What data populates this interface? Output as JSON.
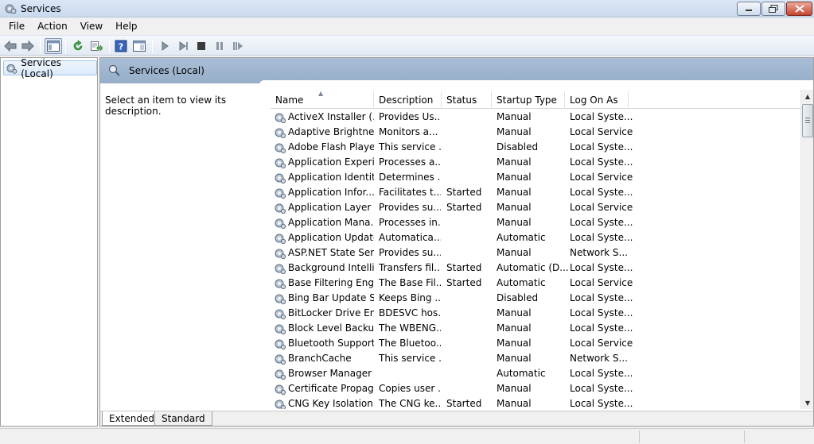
{
  "window": {
    "title": "Services",
    "icon": "services-gear-icon",
    "buttons": {
      "minimize": "minimize-icon",
      "maximize": "restore-icon",
      "close": "close-icon"
    }
  },
  "menu": {
    "items": [
      {
        "label": "File"
      },
      {
        "label": "Action"
      },
      {
        "label": "View"
      },
      {
        "label": "Help"
      }
    ]
  },
  "toolbar": {
    "icons": [
      "back-arrow-icon",
      "forward-arrow-icon",
      "show-hide-console-tree-icon",
      "refresh-icon",
      "export-list-icon",
      "help-icon",
      "properties-pane-icon",
      "start-service-icon",
      "start-alt-service-icon",
      "stop-service-icon",
      "pause-service-icon",
      "resume-service-icon"
    ]
  },
  "tree": {
    "root_label": "Services (Local)"
  },
  "main": {
    "header_title": "Services (Local)",
    "description_hint": "Select an item to view its description.",
    "columns": [
      "Name",
      "Description",
      "Status",
      "Startup Type",
      "Log On As"
    ],
    "rows": [
      {
        "name": "ActiveX Installer (...",
        "description": "Provides Us...",
        "status": "",
        "startup": "Manual",
        "logon": "Local Syste..."
      },
      {
        "name": "Adaptive Brightness",
        "description": "Monitors a...",
        "status": "",
        "startup": "Manual",
        "logon": "Local Service"
      },
      {
        "name": "Adobe Flash Playe...",
        "description": "This service ...",
        "status": "",
        "startup": "Disabled",
        "logon": "Local Syste..."
      },
      {
        "name": "Application Experi...",
        "description": "Processes a...",
        "status": "",
        "startup": "Manual",
        "logon": "Local Syste..."
      },
      {
        "name": "Application Identity",
        "description": "Determines ...",
        "status": "",
        "startup": "Manual",
        "logon": "Local Service"
      },
      {
        "name": "Application Infor...",
        "description": "Facilitates t...",
        "status": "Started",
        "startup": "Manual",
        "logon": "Local Syste..."
      },
      {
        "name": "Application Layer ...",
        "description": "Provides su...",
        "status": "Started",
        "startup": "Manual",
        "logon": "Local Service"
      },
      {
        "name": "Application Mana...",
        "description": "Processes in...",
        "status": "",
        "startup": "Manual",
        "logon": "Local Syste..."
      },
      {
        "name": "Application Updater",
        "description": "Automatica...",
        "status": "",
        "startup": "Automatic",
        "logon": "Local Syste..."
      },
      {
        "name": "ASP.NET State Ser...",
        "description": "Provides su...",
        "status": "",
        "startup": "Manual",
        "logon": "Network S..."
      },
      {
        "name": "Background Intelli...",
        "description": "Transfers fil...",
        "status": "Started",
        "startup": "Automatic (D...",
        "logon": "Local Syste..."
      },
      {
        "name": "Base Filtering Engi...",
        "description": "The Base Fil...",
        "status": "Started",
        "startup": "Automatic",
        "logon": "Local Service"
      },
      {
        "name": "Bing Bar Update S...",
        "description": "Keeps Bing ...",
        "status": "",
        "startup": "Disabled",
        "logon": "Local Syste..."
      },
      {
        "name": "BitLocker Drive En...",
        "description": "BDESVC hos...",
        "status": "",
        "startup": "Manual",
        "logon": "Local Syste..."
      },
      {
        "name": "Block Level Backu...",
        "description": "The WBENG...",
        "status": "",
        "startup": "Manual",
        "logon": "Local Syste..."
      },
      {
        "name": "Bluetooth Support...",
        "description": "The Bluetoo...",
        "status": "",
        "startup": "Manual",
        "logon": "Local Service"
      },
      {
        "name": "BranchCache",
        "description": "This service ...",
        "status": "",
        "startup": "Manual",
        "logon": "Network S..."
      },
      {
        "name": "Browser Manager",
        "description": "",
        "status": "",
        "startup": "Automatic",
        "logon": "Local Syste..."
      },
      {
        "name": "Certificate Propag...",
        "description": "Copies user ...",
        "status": "",
        "startup": "Manual",
        "logon": "Local Syste..."
      },
      {
        "name": "CNG Key Isolation",
        "description": "The CNG ke...",
        "status": "Started",
        "startup": "Manual",
        "logon": "Local Syste..."
      }
    ]
  },
  "tabs": [
    {
      "label": "Extended"
    },
    {
      "label": "Standard"
    }
  ]
}
